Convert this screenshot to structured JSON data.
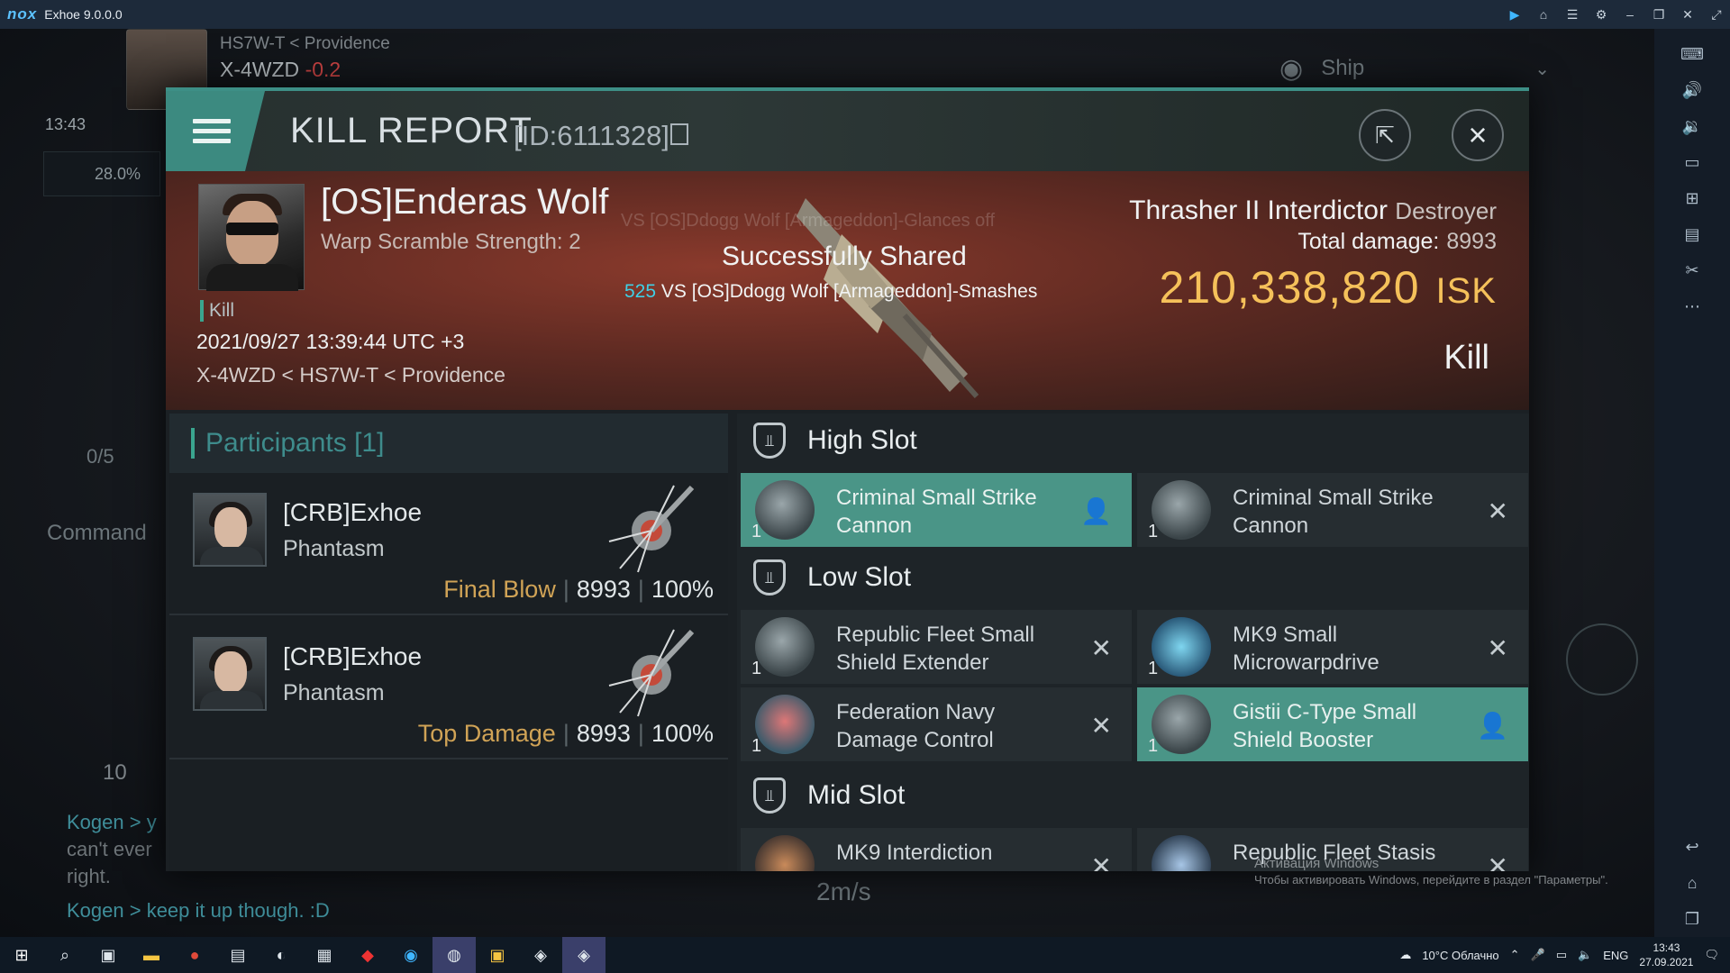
{
  "titlebar": {
    "logo": "nox",
    "title": "Exhoe 9.0.0.0",
    "controls": [
      "play-icon",
      "home-icon",
      "menu-icon",
      "gear-icon",
      "minimize-icon",
      "restore-icon",
      "close-icon",
      "fullscreen-icon"
    ]
  },
  "game_bg": {
    "system_path": "HS7W-T < Providence",
    "system_name": "X-4WZD",
    "security": "-0.2",
    "clock": "13:43",
    "cargo_percent": "28.0%",
    "command": "Command",
    "fleet_count": "0/5",
    "chat_count": "10",
    "chat_lines": [
      "Kogen > y",
      "can't ever",
      "right.",
      "Kogen > keep it up though. :D"
    ],
    "speed": "2m/s",
    "view_filter": "Ship"
  },
  "dialog": {
    "title": "KILL REPORT",
    "id": "[ID:6111328]"
  },
  "victim": {
    "name": "[OS]Enderas Wolf",
    "subtitle": "Warp Scramble Strength: 2",
    "tag": "Kill",
    "time": "2021/09/27 13:39:44 UTC +3",
    "location": "X-4WZD < HS7W-T < Providence",
    "ship_name": "Thrasher II Interdictor",
    "ship_class": "Destroyer",
    "total_damage_label": "Total damage:",
    "total_damage": "8993",
    "isk": "210,338,820",
    "isk_unit": "ISK",
    "result": "Kill"
  },
  "toast": {
    "shared": "Successfully Shared",
    "ticker_num": "525",
    "ticker_text": " VS [OS]Ddogg Wolf [Armageddon]-Smashes",
    "ghost": "VS [OS]Ddogg Wolf [Armageddon]-Glances off"
  },
  "participants": {
    "header": "Participants [1]",
    "rows": [
      {
        "name": "[CRB]Exhoe",
        "ship": "Phantasm",
        "tag": "Final Blow",
        "damage": "8993",
        "percent": "100%"
      },
      {
        "name": "[CRB]Exhoe",
        "ship": "Phantasm",
        "tag": "Top Damage",
        "damage": "8993",
        "percent": "100%"
      }
    ]
  },
  "slots": {
    "high": {
      "title": "High Slot",
      "modules": [
        {
          "name": "Criminal Small Strike Cannon",
          "qty": "1",
          "status": "dropped",
          "flag_icon": "person-icon"
        },
        {
          "name": "Criminal Small Strike Cannon",
          "qty": "1",
          "status": "destroyed",
          "flag_icon": "cross-icon"
        }
      ]
    },
    "low": {
      "title": "Low Slot",
      "modules": [
        {
          "name": "Republic Fleet Small Shield Extender",
          "qty": "1",
          "status": "destroyed",
          "flag_icon": "cross-icon"
        },
        {
          "name": "MK9 Small Microwarpdrive",
          "qty": "1",
          "status": "destroyed",
          "flag_icon": "cross-icon"
        },
        {
          "name": "Federation Navy Damage Control",
          "qty": "1",
          "status": "destroyed",
          "flag_icon": "cross-icon"
        },
        {
          "name": "Gistii C-Type Small Shield Booster",
          "qty": "1",
          "status": "dropped",
          "flag_icon": "person-icon"
        }
      ]
    },
    "mid": {
      "title": "Mid Slot",
      "modules": [
        {
          "name": "MK9 Interdiction",
          "qty": "1",
          "status": "destroyed",
          "flag_icon": "cross-icon"
        },
        {
          "name": "Republic Fleet Stasis",
          "qty": "1",
          "status": "destroyed",
          "flag_icon": "cross-icon"
        }
      ]
    }
  },
  "windows_activation": {
    "line1": "Активация Windows",
    "line2": "Чтобы активировать Windows, перейдите в раздел \"Параметры\"."
  },
  "taskbar": {
    "weather": "10°C Облачно",
    "lang": "ENG",
    "time": "13:43",
    "date": "27.09.2021"
  },
  "colors": {
    "accent_teal": "#3c8a80",
    "isk_gold": "#f5c15a",
    "final_blow": "#d0a356",
    "ticker_cyan": "#3fd0e6"
  }
}
